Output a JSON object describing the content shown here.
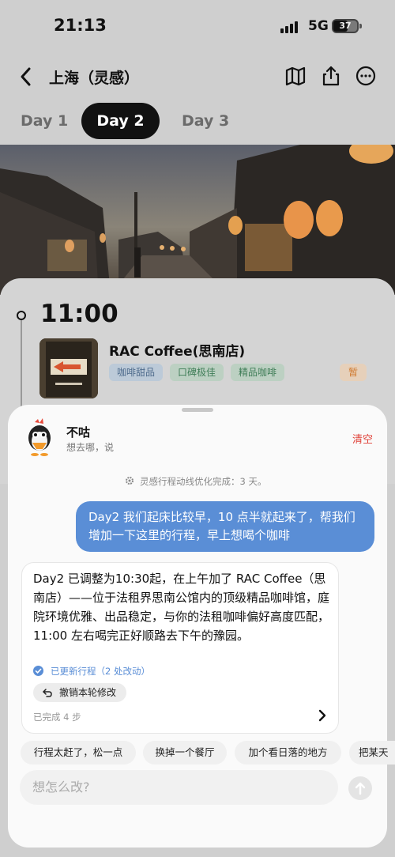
{
  "status": {
    "time": "21:13",
    "network": "5G",
    "battery": "37"
  },
  "header": {
    "title": "上海（灵感）",
    "icons": [
      "back-icon",
      "map-icon",
      "share-icon",
      "more-icon"
    ]
  },
  "tabs": [
    {
      "label": "Day 1"
    },
    {
      "label": "Day 2",
      "active": true
    },
    {
      "label": "Day 3"
    }
  ],
  "itinerary": {
    "time": "11:00",
    "place": "RAC Coffee(思南店)",
    "tags": [
      "咖啡甜品",
      "口碑极佳",
      "精品咖啡",
      "暂"
    ]
  },
  "chat": {
    "bot_name": "不咕",
    "bot_subtitle": "想去哪，说",
    "clear_label": "清空",
    "system_note": "灵感行程动线优化完成：3 天。",
    "user_message": "Day2 我们起床比较早，10 点半就起来了，帮我们增加一下这里的行程，早上想喝个咖啡",
    "ai_message": "Day2 已调整为10:30起，在上午加了 RAC Coffee（思南店）——位于法租界思南公馆内的顶级精品咖啡馆，庭院环境优雅、出品稳定，与你的法租咖啡偏好高度匹配，11:00 左右喝完正好顺路去下午的豫园。",
    "updated_label": "已更新行程（2 处改动）",
    "undo_label": "撤销本轮修改",
    "done_label": "已完成 4 步",
    "suggestions": [
      "行程太赶了，松一点",
      "换掉一个餐厅",
      "加个看日落的地方",
      "把某天"
    ],
    "input_placeholder": "想怎么改?"
  },
  "colors": {
    "accent": "#5a8ed6",
    "danger": "#e0433a",
    "dark": "#111111"
  }
}
